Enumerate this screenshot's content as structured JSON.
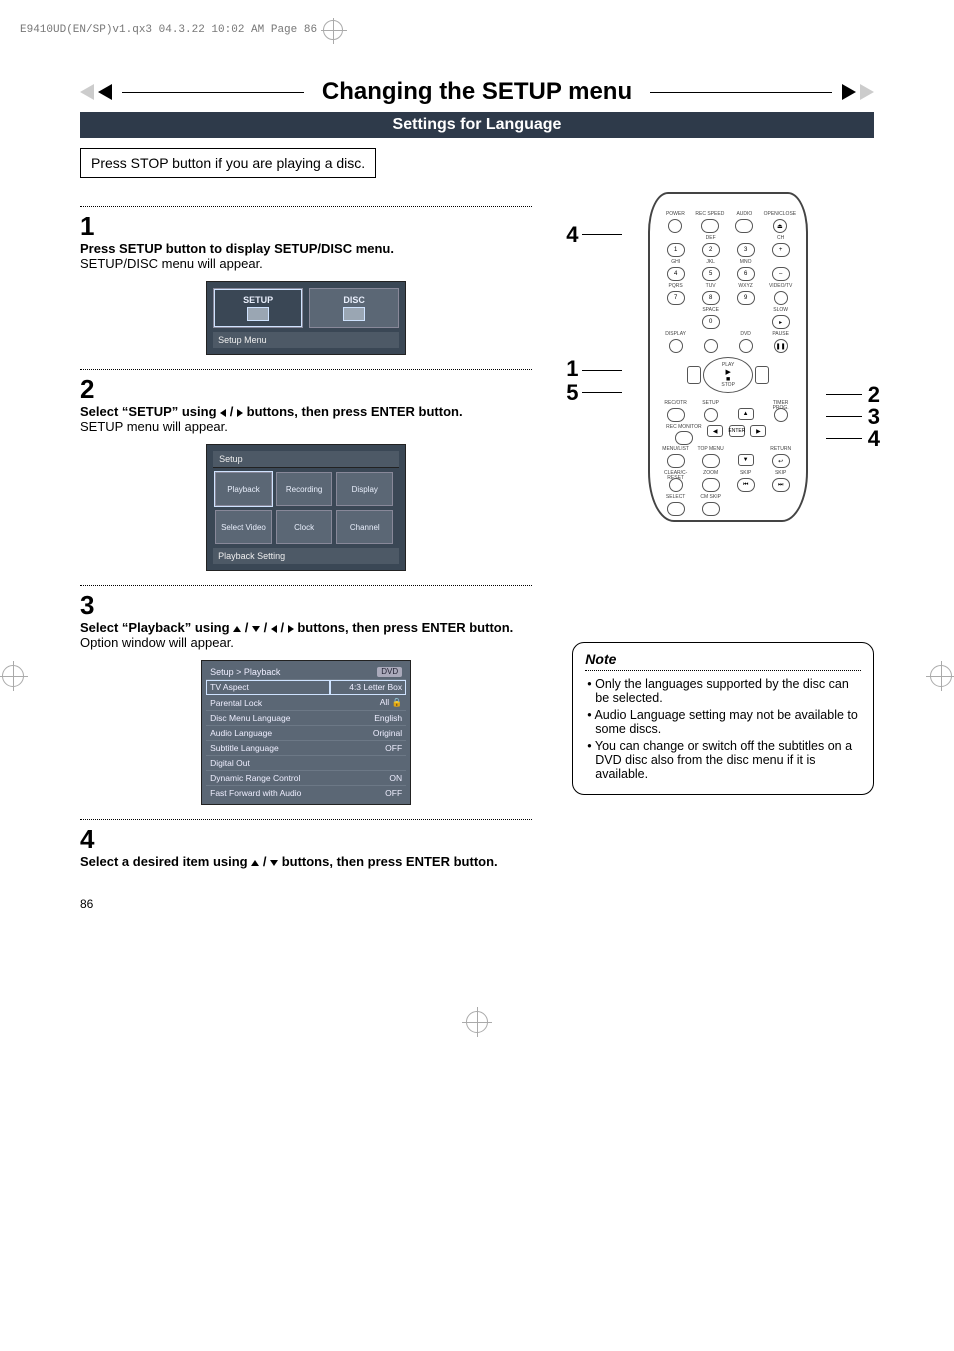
{
  "slug": "E9410UD(EN/SP)v1.qx3  04.3.22  10:02 AM  Page 86",
  "header": {
    "title": "Changing the SETUP menu",
    "subtitle": "Settings for Language"
  },
  "press_stop": "Press STOP button if you are playing a disc.",
  "steps": {
    "s1": {
      "num": "1",
      "head": "Press SETUP button to display SETUP/DISC menu.",
      "sub": "SETUP/DISC menu will appear.",
      "osd_tiles": {
        "a": "SETUP",
        "b": "DISC"
      },
      "osd_caption": "Setup Menu"
    },
    "s2": {
      "num": "2",
      "head_pre": "Select “SETUP” using ",
      "head_post": " buttons, then press ENTER button.",
      "sub": "SETUP menu will appear.",
      "osd_header": "Setup",
      "osd_grid": [
        "Playback",
        "Recording",
        "Display",
        "Select Video",
        "Clock",
        "Channel"
      ],
      "osd_caption": "Playback Setting"
    },
    "s3": {
      "num": "3",
      "head_pre": "Select “Playback” using ",
      "head_post": " buttons, then press ENTER button.",
      "sub": "Option window will appear.",
      "osd_header": "Setup > Playback",
      "osd_tag": "DVD",
      "osd_rows": [
        {
          "k": "TV Aspect",
          "v": "4:3 Letter Box"
        },
        {
          "k": "Parental Lock",
          "v": "All"
        },
        {
          "k": "Disc Menu Language",
          "v": "English"
        },
        {
          "k": "Audio Language",
          "v": "Original"
        },
        {
          "k": "Subtitle Language",
          "v": "OFF"
        },
        {
          "k": "Digital Out",
          "v": ""
        },
        {
          "k": "Dynamic Range Control",
          "v": "ON"
        },
        {
          "k": "Fast Forward with Audio",
          "v": "OFF"
        }
      ]
    },
    "s4": {
      "num": "4",
      "head_pre": "Select a desired item using ",
      "head_post": " buttons, then press ENTER button."
    }
  },
  "remote_callouts": {
    "left": [
      "4",
      "1",
      "5"
    ],
    "right": [
      "2",
      "3",
      "4"
    ]
  },
  "remote": {
    "row1": [
      "POWER",
      "REC SPEED",
      "AUDIO",
      "OPEN/CLOSE"
    ],
    "row2": [
      "",
      "DEF",
      "",
      "CH"
    ],
    "numrow1": [
      "1",
      "2",
      "3",
      ""
    ],
    "row3": [
      "GHI",
      "JKL",
      "MNO",
      ""
    ],
    "numrow2": [
      "4",
      "5",
      "6",
      ""
    ],
    "row4": [
      "PQRS",
      "TUV",
      "WXYZ",
      "VIDEO/TV"
    ],
    "numrow3": [
      "7",
      "8",
      "9",
      ""
    ],
    "row5": [
      "",
      "SPACE",
      "",
      "SLOW"
    ],
    "numrow4": [
      "",
      "0",
      "",
      ""
    ],
    "row6": [
      "DISPLAY",
      "",
      "DVD",
      "PAUSE"
    ],
    "dpad": {
      "up": "PLAY",
      "down": "STOP"
    },
    "row7": [
      "REC/OTR",
      "SETUP",
      "",
      "TIMER PROG."
    ],
    "row8": [
      "REC MONITOR",
      "",
      "ENTER",
      ""
    ],
    "row9": [
      "MENU/LIST",
      "TOP MENU",
      "",
      "RETURN"
    ],
    "row10": [
      "CLEAR/C-RESET",
      "ZOOM",
      "SKIP",
      "SKIP"
    ],
    "row11": [
      "SELECT",
      "CM SKIP",
      "",
      ""
    ]
  },
  "note": {
    "hdr": "Note",
    "items": [
      "Only the languages supported by the disc can be selected.",
      "Audio Language setting may not be available to some discs.",
      "You can change or switch off the subtitles on a DVD disc also from the disc menu if it is available."
    ]
  },
  "pagenum": "86"
}
